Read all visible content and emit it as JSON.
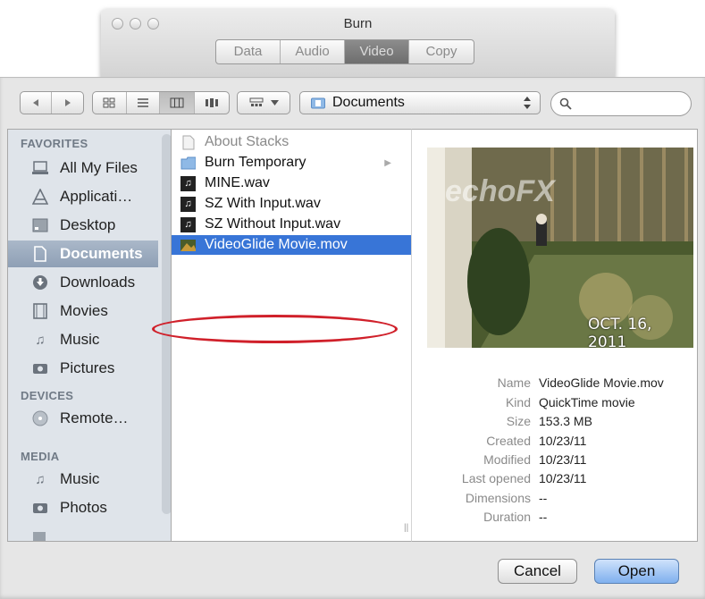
{
  "burn_window": {
    "title": "Burn",
    "tabs": [
      {
        "label": "Data",
        "active": false
      },
      {
        "label": "Audio",
        "active": false
      },
      {
        "label": "Video",
        "active": true
      },
      {
        "label": "Copy",
        "active": false
      }
    ]
  },
  "toolbar": {
    "location": "Documents",
    "search_placeholder": ""
  },
  "sidebar": {
    "sections": [
      {
        "header": "FAVORITES",
        "items": [
          {
            "label": "All My Files",
            "icon": "all-files-icon",
            "selected": false
          },
          {
            "label": "Applicati…",
            "icon": "applications-icon",
            "selected": false
          },
          {
            "label": "Desktop",
            "icon": "desktop-icon",
            "selected": false
          },
          {
            "label": "Documents",
            "icon": "documents-icon",
            "selected": true
          },
          {
            "label": "Downloads",
            "icon": "downloads-icon",
            "selected": false
          },
          {
            "label": "Movies",
            "icon": "movies-icon",
            "selected": false
          },
          {
            "label": "Music",
            "icon": "music-icon",
            "selected": false
          },
          {
            "label": "Pictures",
            "icon": "pictures-icon",
            "selected": false
          }
        ]
      },
      {
        "header": "DEVICES",
        "items": [
          {
            "label": "Remote…",
            "icon": "remote-disc-icon",
            "selected": false
          }
        ]
      },
      {
        "header": "MEDIA",
        "items": [
          {
            "label": "Music",
            "icon": "music-icon",
            "selected": false
          },
          {
            "label": "Photos",
            "icon": "photos-icon",
            "selected": false
          }
        ]
      }
    ]
  },
  "files": [
    {
      "name": "About Stacks",
      "icon": "document-icon",
      "dim": true,
      "selected": false,
      "folder": false
    },
    {
      "name": "Burn Temporary",
      "icon": "folder-icon",
      "dim": false,
      "selected": false,
      "folder": true
    },
    {
      "name": "MINE.wav",
      "icon": "audio-file-icon",
      "dim": false,
      "selected": false,
      "folder": false
    },
    {
      "name": "SZ With Input.wav",
      "icon": "audio-file-icon",
      "dim": false,
      "selected": false,
      "folder": false
    },
    {
      "name": "SZ Without Input.wav",
      "icon": "audio-file-icon",
      "dim": false,
      "selected": false,
      "folder": false
    },
    {
      "name": "VideoGlide Movie.mov",
      "icon": "movie-file-icon",
      "dim": false,
      "selected": true,
      "folder": false
    }
  ],
  "preview": {
    "watermark": "echoFX",
    "datestamp": "OCT. 16, 2011",
    "info": [
      {
        "key": "Name",
        "value": "VideoGlide Movie.mov"
      },
      {
        "key": "Kind",
        "value": "QuickTime movie"
      },
      {
        "key": "Size",
        "value": "153.3 MB"
      },
      {
        "key": "Created",
        "value": "10/23/11"
      },
      {
        "key": "Modified",
        "value": "10/23/11"
      },
      {
        "key": "Last opened",
        "value": "10/23/11"
      },
      {
        "key": "Dimensions",
        "value": "--"
      },
      {
        "key": "Duration",
        "value": "--"
      }
    ]
  },
  "buttons": {
    "cancel": "Cancel",
    "open": "Open"
  },
  "colors": {
    "selection": "#3875d7",
    "sidebar_bg": "#dfe4ea",
    "highlight_circle": "#d0202a"
  }
}
